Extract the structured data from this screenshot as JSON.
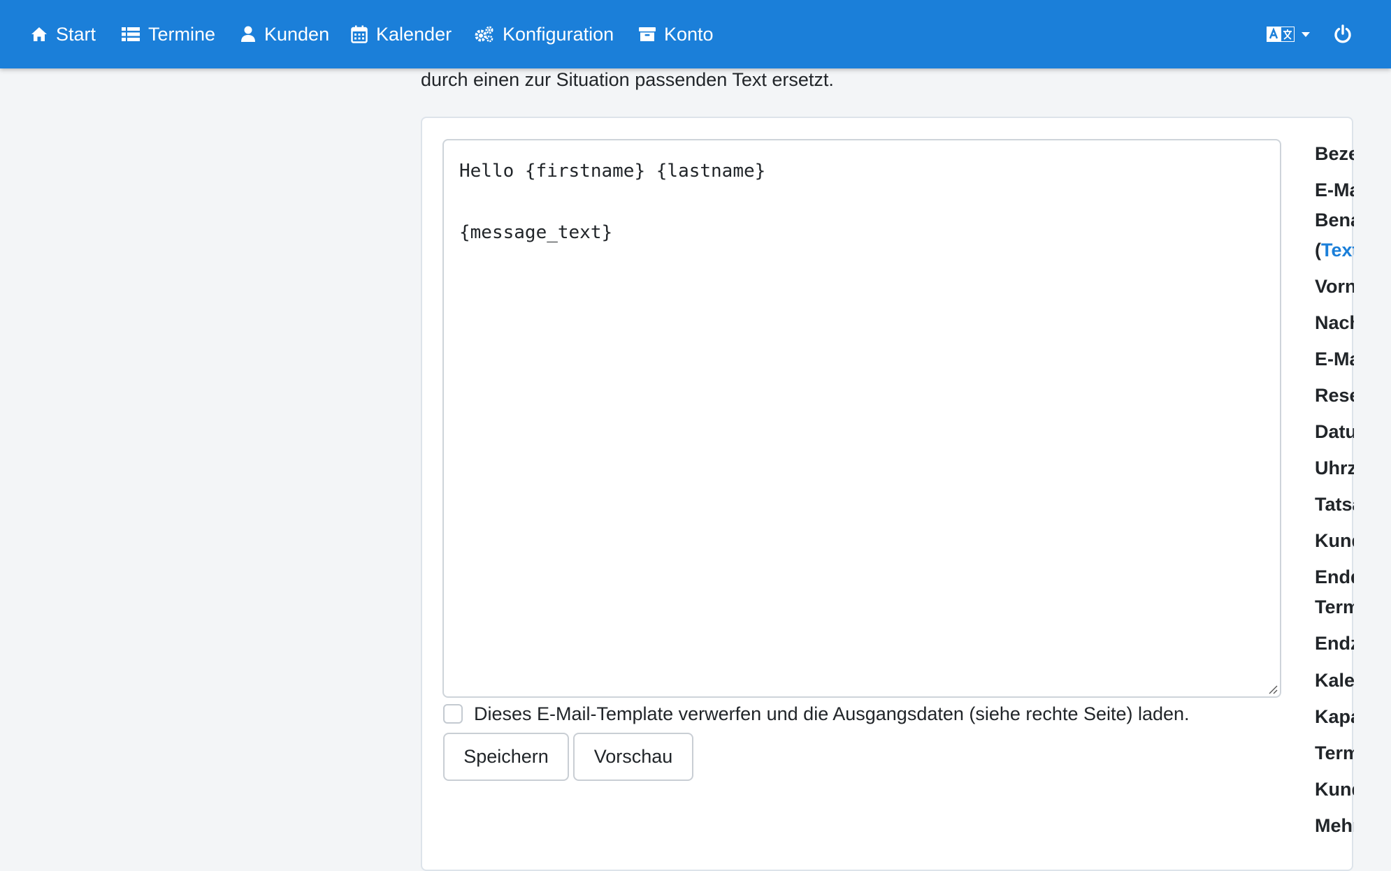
{
  "nav": {
    "items": [
      {
        "label": "Start",
        "icon": "home-icon"
      },
      {
        "label": "Termine",
        "icon": "list-icon"
      },
      {
        "label": "Kunden",
        "icon": "user-icon"
      },
      {
        "label": "Kalender",
        "icon": "calendar-icon"
      },
      {
        "label": "Konfiguration",
        "icon": "cogs-icon"
      },
      {
        "label": "Konto",
        "icon": "archive-icon"
      }
    ],
    "language_icon": "translate-icon",
    "power_icon": "power-icon",
    "bg_color": "#1b7fd9"
  },
  "intro": {
    "text": "durch einen zur Situation passenden Text ersetzt."
  },
  "editor": {
    "content": "Hello {firstname} {lastname}\n\n{message_text}"
  },
  "discard": {
    "label": "Dieses E-Mail-Template verwerfen und die Ausgangsdaten (siehe rechte Seite) laden.",
    "checked": false
  },
  "buttons": {
    "save": "Speichern",
    "preview": "Vorschau"
  },
  "sidebar": {
    "rows": {
      "r0": "Bezeichn",
      "r1": "E-Mail-",
      "r2": "Benachri",
      "r3_paren": "(",
      "r3_link": "Texte b",
      "r4": "Vorname",
      "r5": "Nachnam",
      "r6": "E-Mail",
      "r7": "Reservie",
      "r8": "Datum",
      "r9": "Uhrzeit",
      "r10": "Tatsächl",
      "r11": "Kunden-",
      "r12": "Enddatu",
      "r13": "Termins",
      "r14": "Endzeit d",
      "r15": "Kalender",
      "r16": "Kapazitä",
      "r17": "Termin-I",
      "r18": "Kundenn",
      "r19": "Mehrfac"
    },
    "link_color": "#1b7fd9"
  }
}
